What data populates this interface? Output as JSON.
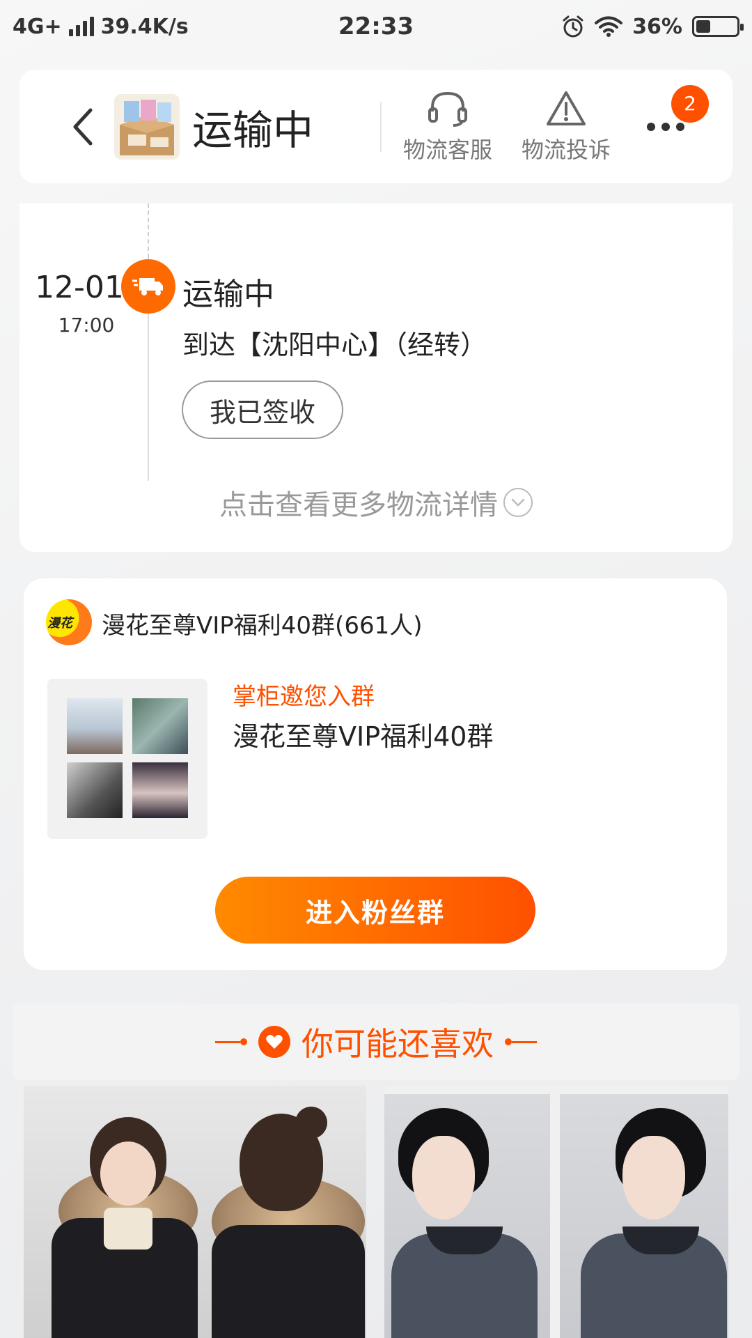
{
  "status_bar": {
    "network": "4G+",
    "speed": "39.4K/s",
    "time": "22:33",
    "battery": "36%",
    "battery_level": 0.36
  },
  "header": {
    "title": "运输中",
    "actions": [
      {
        "label": "物流客服",
        "icon": "headset-icon"
      },
      {
        "label": "物流投诉",
        "icon": "warning-icon"
      }
    ],
    "more_badge": "2"
  },
  "logistics": {
    "date": "12-01",
    "time": "17:00",
    "status": "运输中",
    "detail": "到达【沈阳中心】（经转）",
    "signed_button": "我已签收",
    "more_link": "点击查看更多物流详情"
  },
  "fan_group": {
    "name": "漫花至尊VIP福利40群(661人)",
    "logo_text": "漫花",
    "invite_label": "掌柜邀您入群",
    "group_title": "漫花至尊VIP福利40群",
    "join_button": "进入粉丝群"
  },
  "recommend": {
    "title": "你可能还喜欢"
  },
  "colors": {
    "accent": "#ff5000",
    "accent_light": "#ff8a00",
    "background": "#efefef"
  }
}
